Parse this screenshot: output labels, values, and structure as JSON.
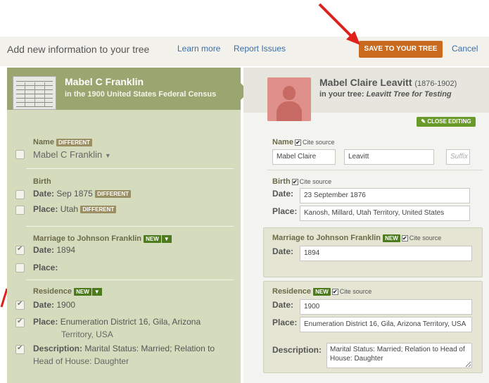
{
  "topbar": {
    "title": "Add new information to your tree",
    "learn_more": "Learn more",
    "report_issues": "Report Issues",
    "save_label": "SAVE TO YOUR TREE",
    "cancel_label": "Cancel"
  },
  "record": {
    "name": "Mabel C Franklin",
    "source": "in the 1900 United States Federal Census"
  },
  "tree_person": {
    "name": "Mabel Claire Leavitt",
    "years": "(1876-1902)",
    "sub_prefix": "in your tree: ",
    "tree_name": "Leavitt Tree for Testing",
    "close_editing": "CLOSE EDITING"
  },
  "left": {
    "name_label": "Name",
    "name_value": "Mabel C Franklin",
    "birth_label": "Birth",
    "birth_date_label": "Date:",
    "birth_date_value": "Sep 1875",
    "birth_place_label": "Place:",
    "birth_place_value": "Utah",
    "marriage_label": "Marriage to Johnson Franklin",
    "marriage_date_label": "Date:",
    "marriage_date_value": "1894",
    "marriage_place_label": "Place:",
    "residence_label": "Residence",
    "res_date_label": "Date:",
    "res_date_value": "1900",
    "res_place_label": "Place:",
    "res_place_value_1": "Enumeration District 16, Gila, Arizona",
    "res_place_value_2": "Territory, USA",
    "res_desc_label": "Description:",
    "res_desc_value_1": "Marital Status: Married; Relation to",
    "res_desc_value_2": "Head of House: Daughter",
    "badge_different": "DIFFERENT",
    "badge_new": "NEW"
  },
  "right": {
    "cite_source": "Cite source",
    "name_label": "Name",
    "given_name": "Mabel Claire",
    "surname": "Leavitt",
    "suffix_placeholder": "Suffix",
    "birth_label": "Birth",
    "birth_date_label": "Date:",
    "birth_date": "23 September 1876",
    "birth_place_label": "Place:",
    "birth_place": "Kanosh, Millard, Utah Territory, United States",
    "marriage_label": "Marriage to Johnson Franklin",
    "marriage_date_label": "Date:",
    "marriage_date": "1894",
    "residence_label": "Residence",
    "res_date_label": "Date:",
    "res_date": "1900",
    "res_place_label": "Place:",
    "res_place": "Enumeration District 16, Gila, Arizona Territory, USA",
    "res_desc_label": "Description:",
    "res_desc": "Marital Status: Married; Relation to Head of House: Daughter"
  },
  "colors": {
    "save_button": "#c96a1e",
    "left_header": "#9aa56f",
    "left_panel": "#d5dcbd",
    "badge_new": "#4d7a1c",
    "annotation_arrow": "#e0201a"
  }
}
